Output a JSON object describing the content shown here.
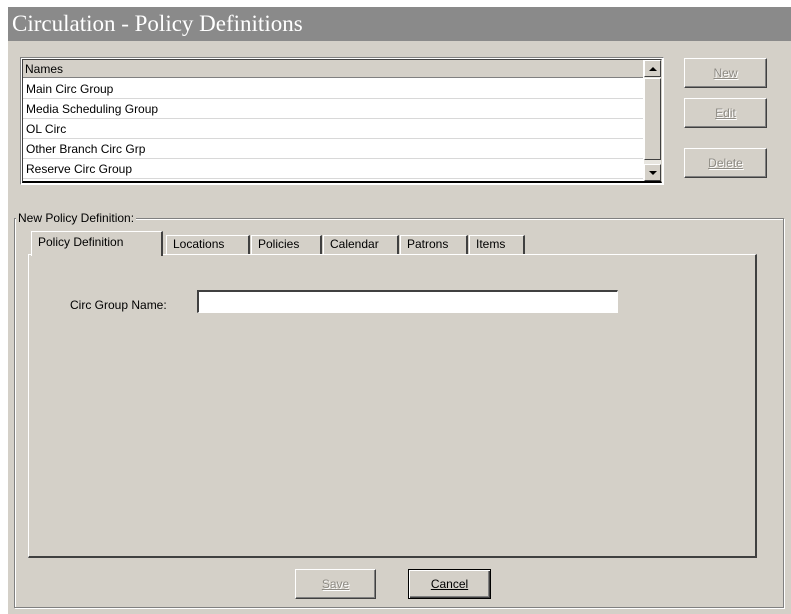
{
  "window": {
    "title": "Circulation - Policy Definitions"
  },
  "names_list": {
    "header": "Names",
    "items": [
      "Main Circ Group",
      "Media Scheduling Group",
      "OL Circ",
      "Other Branch Circ Grp",
      "Reserve Circ Group"
    ]
  },
  "buttons": {
    "new": {
      "label": "New",
      "enabled": true
    },
    "edit": {
      "label": "Edit",
      "enabled": false
    },
    "delete": {
      "label": "Delete",
      "enabled": false
    },
    "save": {
      "label": "Save",
      "enabled": false
    },
    "cancel": {
      "label": "Cancel",
      "enabled": true
    }
  },
  "group": {
    "label": "New  Policy Definition:"
  },
  "tabs": [
    {
      "label": "Policy Definition",
      "active": true
    },
    {
      "label": "Locations"
    },
    {
      "label": "Policies"
    },
    {
      "label": "Calendar"
    },
    {
      "label": "Patrons"
    },
    {
      "label": "Items"
    }
  ],
  "form": {
    "circ_group_name_label": "Circ Group Name:",
    "circ_group_name_value": ""
  },
  "icons": {
    "scroll_up": "scroll-up-arrow-icon",
    "scroll_down": "scroll-down-arrow-icon"
  },
  "colors": {
    "titlebar": "#8a8a8a",
    "dialog": "#d4d0c8"
  }
}
